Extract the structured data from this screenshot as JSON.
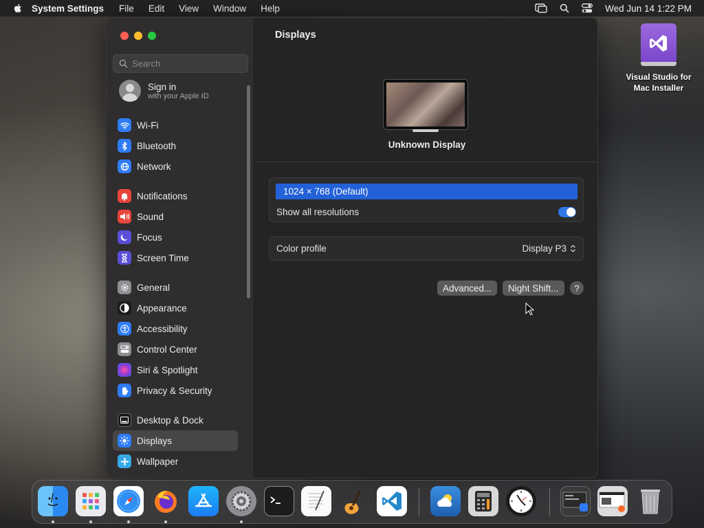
{
  "menubar": {
    "app_name": "System Settings",
    "menus": [
      "File",
      "Edit",
      "View",
      "Window",
      "Help"
    ],
    "datetime": "Wed Jun 14  1:22 PM"
  },
  "sidebar": {
    "search_placeholder": "Search",
    "signin": {
      "title": "Sign in",
      "subtitle": "with your Apple ID"
    },
    "groups": [
      [
        {
          "label": "Wi-Fi",
          "icon": "wifi-icon",
          "color": "#2f7cf6"
        },
        {
          "label": "Bluetooth",
          "icon": "bluetooth-icon",
          "color": "#2f7cf6"
        },
        {
          "label": "Network",
          "icon": "network-globe-icon",
          "color": "#2f7cf6"
        }
      ],
      [
        {
          "label": "Notifications",
          "icon": "bell-icon",
          "color": "#e8453c"
        },
        {
          "label": "Sound",
          "icon": "speaker-icon",
          "color": "#e8453c"
        },
        {
          "label": "Focus",
          "icon": "moon-icon",
          "color": "#5a4fd8"
        },
        {
          "label": "Screen Time",
          "icon": "hourglass-icon",
          "color": "#5a4fd8"
        }
      ],
      [
        {
          "label": "General",
          "icon": "gear-icon",
          "color": "#8e8e93"
        },
        {
          "label": "Appearance",
          "icon": "appearance-icon",
          "color": "#1c1c1e"
        },
        {
          "label": "Accessibility",
          "icon": "accessibility-icon",
          "color": "#2f7cf6"
        },
        {
          "label": "Control Center",
          "icon": "control-center-icon",
          "color": "#8e8e93"
        },
        {
          "label": "Siri & Spotlight",
          "icon": "siri-icon",
          "color": "#a23bd1"
        },
        {
          "label": "Privacy & Security",
          "icon": "hand-icon",
          "color": "#2f7cf6"
        }
      ],
      [
        {
          "label": "Desktop & Dock",
          "icon": "dock-icon",
          "color": "#1c1c1e"
        },
        {
          "label": "Displays",
          "icon": "sun-icon",
          "color": "#2f7cf6",
          "active": true
        },
        {
          "label": "Wallpaper",
          "icon": "wallpaper-icon",
          "color": "#35a9e8"
        }
      ]
    ]
  },
  "main": {
    "title": "Displays",
    "display_name": "Unknown Display",
    "resolution_selected": "1024 × 768 (Default)",
    "show_all_label": "Show all resolutions",
    "show_all_enabled": true,
    "color_profile_label": "Color profile",
    "color_profile_value": "Display P3",
    "advanced_label": "Advanced...",
    "night_shift_label": "Night Shift...",
    "help_label": "?"
  },
  "desktop": {
    "icon_label_line1": "Visual Studio for",
    "icon_label_line2": "Mac Installer"
  },
  "dock": {
    "apps": [
      {
        "name": "finder-icon",
        "running": true
      },
      {
        "name": "launchpad-icon",
        "running": true
      },
      {
        "name": "safari-icon",
        "running": true
      },
      {
        "name": "firefox-icon",
        "running": true
      },
      {
        "name": "app-store-icon",
        "running": false
      },
      {
        "name": "system-settings-icon",
        "running": true
      },
      {
        "name": "terminal-icon",
        "running": false
      },
      {
        "name": "textedit-icon",
        "running": false
      },
      {
        "name": "garageband-icon",
        "running": false
      },
      {
        "name": "vscode-icon",
        "running": false
      },
      {
        "name": "weather-icon",
        "running": false
      },
      {
        "name": "calculator-icon",
        "running": false
      },
      {
        "name": "clock-icon",
        "running": false
      },
      {
        "name": "downloads-stack-icon",
        "running": false
      },
      {
        "name": "documents-stack-icon",
        "running": false
      },
      {
        "name": "trash-icon",
        "running": false
      }
    ]
  }
}
